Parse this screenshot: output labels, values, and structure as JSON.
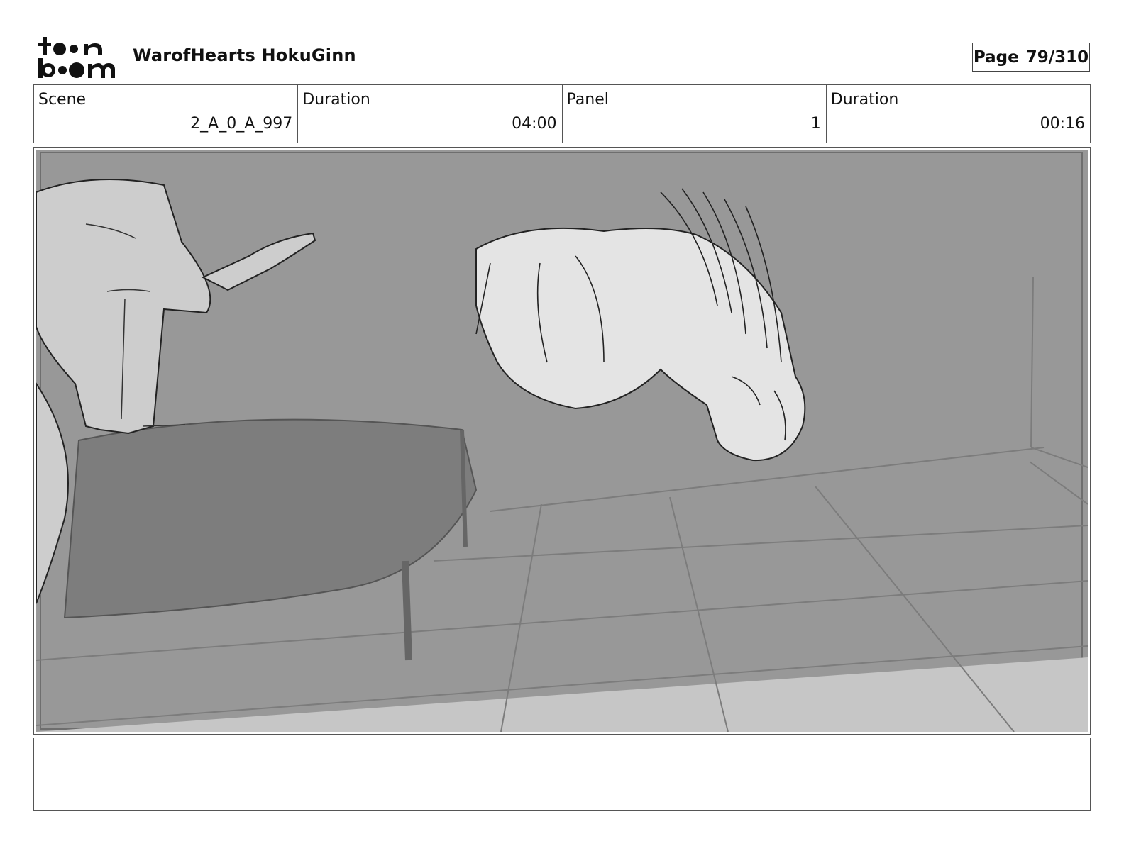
{
  "header": {
    "logo": {
      "text_top": "toon",
      "text_bottom": "boom"
    },
    "project_title": "WarofHearts HokuGinn",
    "page": {
      "label": "Page",
      "value": "79/310"
    }
  },
  "info": {
    "scene": {
      "label": "Scene",
      "value": "2_A_0_A_997"
    },
    "scene_duration": {
      "label": "Duration",
      "value": "04:00"
    },
    "panel": {
      "label": "Panel",
      "value": "1"
    },
    "panel_duration": {
      "label": "Duration",
      "value": "00:16"
    }
  },
  "notes": {
    "text": ""
  }
}
